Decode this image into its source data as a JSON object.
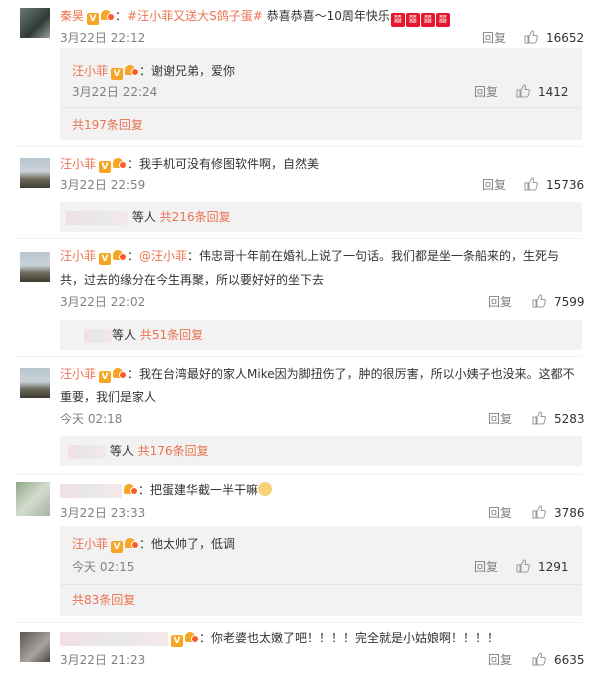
{
  "comments": [
    {
      "name": "秦昊",
      "text_link": "#汪小菲又送大S鸽子蛋#",
      "text": " 恭喜恭喜～10周年快乐",
      "time": "3月22日 22:12",
      "reply_label": "回复",
      "likes": "16652",
      "sub": {
        "name": "汪小菲",
        "text": "：谢谢兄弟，爱你",
        "time": "3月22日 22:24",
        "reply_label": "回复",
        "likes": "1412",
        "more": "共197条回复"
      }
    },
    {
      "name": "汪小菲",
      "text": "：我手机可没有修图软件啊，自然美",
      "time": "3月22日 22:59",
      "reply_label": "回复",
      "likes": "15736",
      "more_prefix": "等人",
      "more": "共216条回复"
    },
    {
      "name": "汪小菲",
      "text_at": "@汪小菲",
      "text_line1": "：伟忠哥十年前在婚礼上说了一句话。我们都是坐一条船来的，生死与",
      "text_line2": "共，过去的缘分在今生再聚，所以要好好的坐下去",
      "time": "3月22日 22:02",
      "reply_label": "回复",
      "likes": "7599",
      "more_prefix": "等人",
      "more": "共51条回复"
    },
    {
      "name": "汪小菲",
      "text_line1": "：我在台湾最好的家人Mike因为脚扭伤了，肿的很厉害，所以小姨子也没来。这都不",
      "text_line2": "重要，我们是家人",
      "time": "今天 02:18",
      "reply_label": "回复",
      "likes": "5283",
      "more_prefix": "等人",
      "more": "共176条回复"
    },
    {
      "text": "：把蛋建华截一半干嘛",
      "time": "3月22日 23:33",
      "reply_label": "回复",
      "likes": "3786",
      "sub": {
        "name": "汪小菲",
        "text": "：他太帅了，低调",
        "time": "今天 02:15",
        "reply_label": "回复",
        "likes": "1291",
        "more": "共83条回复"
      }
    },
    {
      "text": "：你老婆也太嫩了吧！！！！完全就是小姑娘啊！！！！",
      "time": "3月22日 21:23",
      "reply_label": "回复",
      "likes": "6635"
    }
  ],
  "badges": {
    "v_label": "V",
    "emoji_label": "囍"
  },
  "colors": {
    "name": "#eb7350",
    "meta": "#808080",
    "subbox": "#f2f2f2"
  }
}
